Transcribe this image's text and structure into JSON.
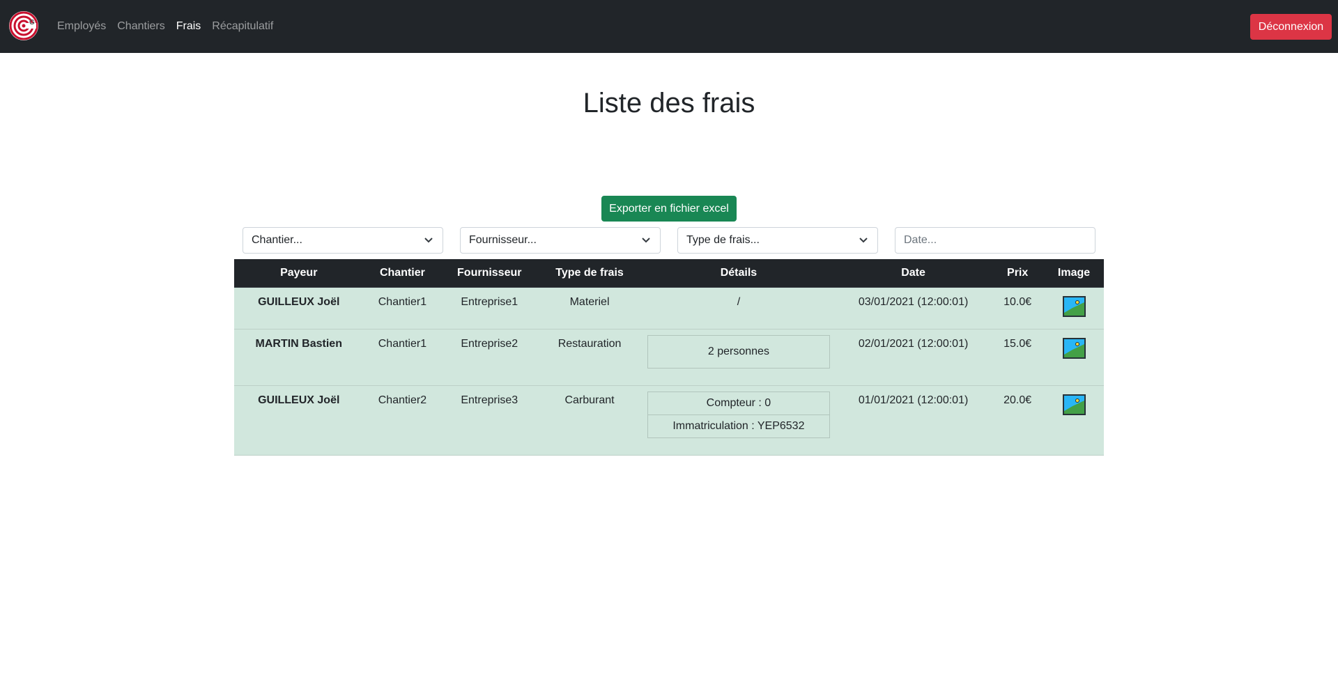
{
  "navbar": {
    "links": [
      {
        "label": "Employés",
        "active": false
      },
      {
        "label": "Chantiers",
        "active": false
      },
      {
        "label": "Frais",
        "active": true
      },
      {
        "label": "Récapitulatif",
        "active": false
      }
    ],
    "logout_label": "Déconnexion",
    "colors": {
      "background": "#212529",
      "danger": "#dc3545"
    }
  },
  "page": {
    "title": "Liste des frais",
    "export_label": "Exporter en fichier excel",
    "accent_success": "#198754"
  },
  "filters": {
    "chantier": "Chantier...",
    "fournisseur": "Fournisseur...",
    "type_frais": "Type de frais...",
    "date_placeholder": "Date..."
  },
  "table": {
    "headers": [
      "Payeur",
      "Chantier",
      "Fournisseur",
      "Type de frais",
      "Détails",
      "Date",
      "Prix",
      "Image"
    ],
    "rows": [
      {
        "payer": "GUILLEUX Joël",
        "chantier": "Chantier1",
        "fournisseur": "Entreprise1",
        "type": "Materiel",
        "details": [
          "/"
        ],
        "date": "03/01/2021 (12:00:01)",
        "prix": "10.0€",
        "image_icon": "image-icon"
      },
      {
        "payer": "MARTIN Bastien",
        "chantier": "Chantier1",
        "fournisseur": "Entreprise2",
        "type": "Restauration",
        "details": [
          "2 personnes"
        ],
        "date": "02/01/2021 (12:00:01)",
        "prix": "15.0€",
        "image_icon": "image-icon"
      },
      {
        "payer": "GUILLEUX Joël",
        "chantier": "Chantier2",
        "fournisseur": "Entreprise3",
        "type": "Carburant",
        "details": [
          "Compteur : 0",
          "Immatriculation : YEP6532"
        ],
        "date": "01/01/2021 (12:00:01)",
        "prix": "20.0€",
        "image_icon": "image-icon"
      }
    ],
    "row_color": "#d1e7dd"
  }
}
